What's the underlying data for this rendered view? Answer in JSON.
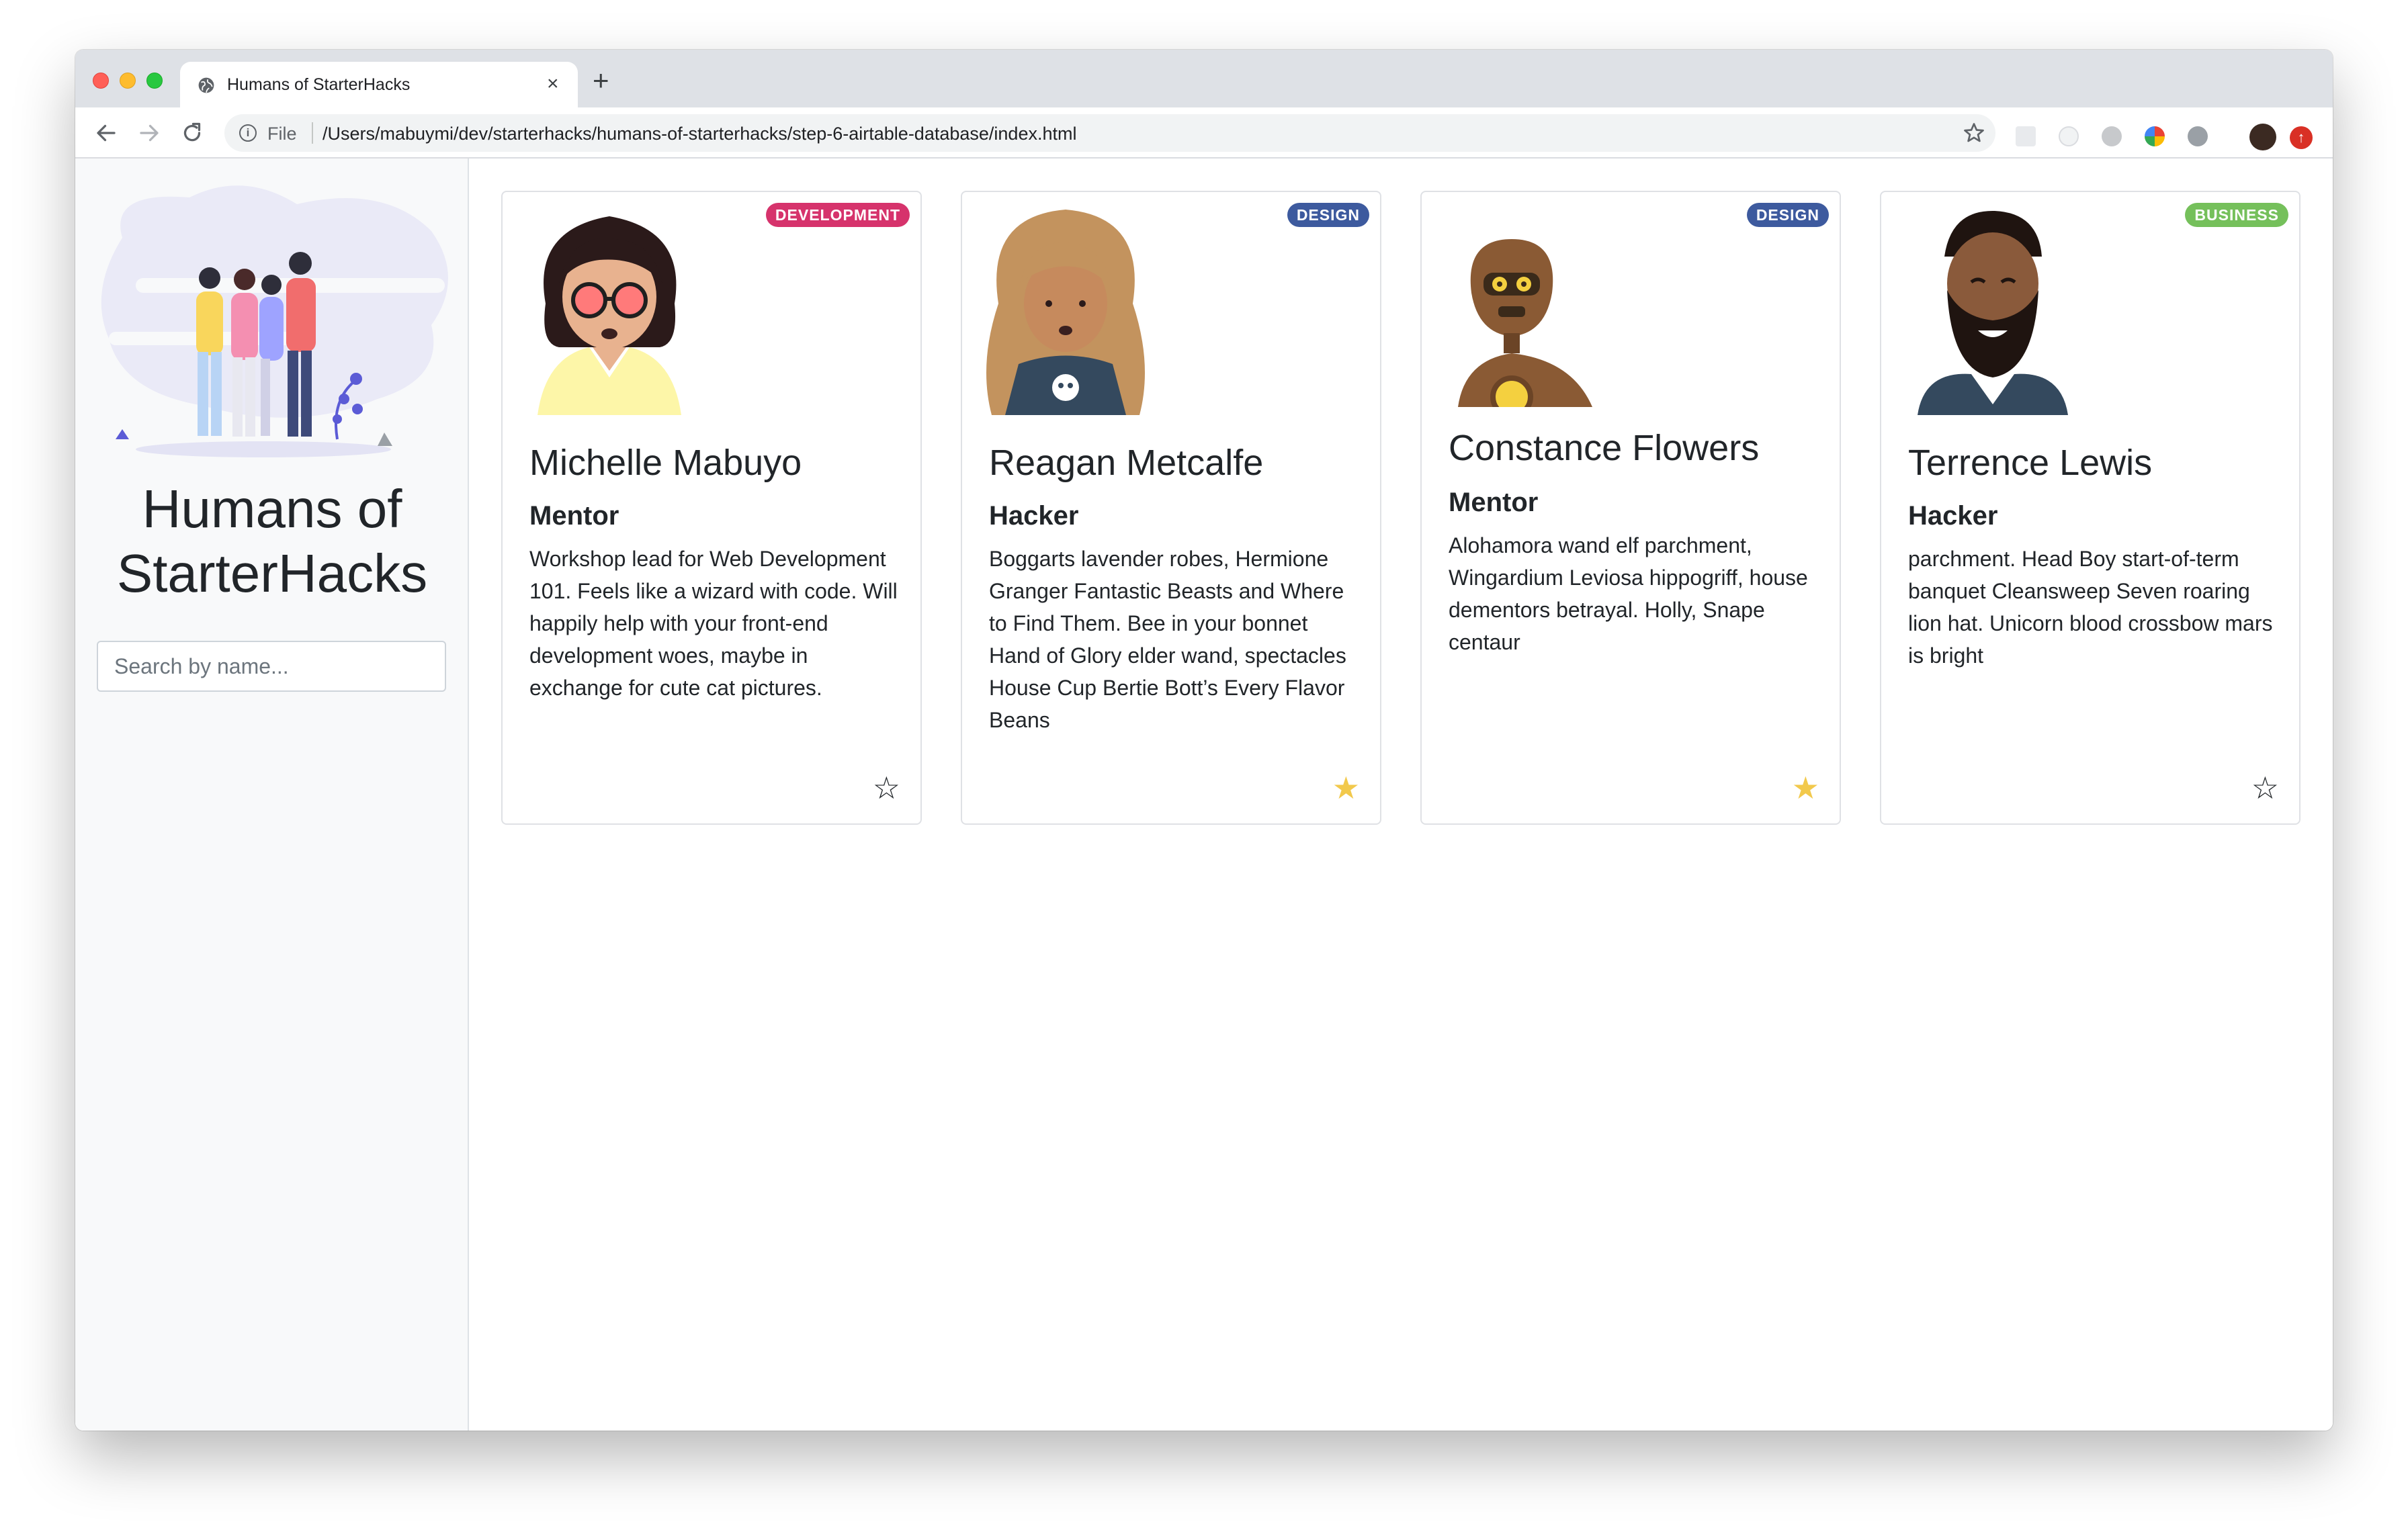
{
  "browser": {
    "tab_title": "Humans of StarterHacks",
    "close_glyph": "×",
    "new_tab_glyph": "+",
    "scheme": "File",
    "url": "/Users/mabuymi/dev/starterhacks/humans-of-starterhacks/step-6-airtable-database/index.html"
  },
  "sidebar": {
    "title": "Humans of StarterHacks",
    "search_placeholder": "Search by name..."
  },
  "colors": {
    "development": "#d6336c",
    "design": "#3d5a9e",
    "business": "#75c05b",
    "star_filled": "#f2c94c",
    "star_empty": "#212529"
  },
  "cards": [
    {
      "name": "Michelle Mabuyo",
      "role": "Mentor",
      "badge": "DEVELOPMENT",
      "bio": "Workshop lead for Web Development 101. Feels like a wizard with code. Will happily help with your front-end development woes, maybe in exchange for cute cat pictures.",
      "favorite": false,
      "star": "☆"
    },
    {
      "name": "Reagan Metcalfe",
      "role": "Hacker",
      "badge": "DESIGN",
      "bio": "Boggarts lavender robes, Hermione Granger Fantastic Beasts and Where to Find Them. Bee in your bonnet Hand of Glory elder wand, spectacles House Cup Bertie Bott’s Every Flavor Beans",
      "favorite": true,
      "star": "★"
    },
    {
      "name": "Constance Flowers",
      "role": "Mentor",
      "badge": "DESIGN",
      "bio": "Alohamora wand elf parchment, Wingardium Leviosa hippogriff, house dementors betrayal. Holly, Snape centaur",
      "favorite": true,
      "star": "★"
    },
    {
      "name": "Terrence Lewis",
      "role": "Hacker",
      "badge": "BUSINESS",
      "bio": "parchment. Head Boy start-of-term banquet Cleansweep Seven roaring lion hat. Unicorn blood crossbow mars is bright",
      "favorite": false,
      "star": "☆"
    }
  ]
}
